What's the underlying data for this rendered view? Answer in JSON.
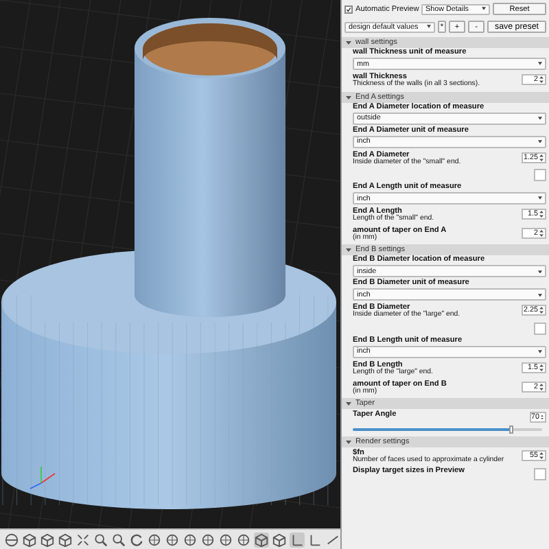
{
  "top_bar": {
    "auto_preview": {
      "label": "Automatic Preview",
      "checked": true
    },
    "details": {
      "value": "Show Details"
    },
    "reset": "Reset"
  },
  "preset_bar": {
    "preset": {
      "value": "design default values"
    },
    "buttons": [
      "*",
      "+",
      "-"
    ],
    "save": "save preset"
  },
  "sections": [
    {
      "title": "wall settings",
      "expanded": true,
      "params": [
        {
          "kind": "select",
          "label": "wall Thickness unit of measure",
          "value": "mm"
        },
        {
          "kind": "number",
          "label": "wall Thickness",
          "description": "Thickness of the walls (in all 3 sections).",
          "value": "2"
        }
      ]
    },
    {
      "title": "End A settings",
      "expanded": true,
      "params": [
        {
          "kind": "select",
          "label": "End A Diameter location of measure",
          "value": "outside"
        },
        {
          "kind": "select",
          "label": "End A Diameter unit of measure",
          "value": "inch"
        },
        {
          "kind": "number",
          "label": "End A Diameter",
          "description": "Inside diameter of the \"small\" end.",
          "value": "1.25"
        },
        {
          "kind": "checkbox",
          "checked": false
        },
        {
          "kind": "select",
          "label": "End A Length unit of measure",
          "value": "inch"
        },
        {
          "kind": "number",
          "label": "End A Length",
          "description": "Length of the \"small\" end.",
          "value": "1.5"
        },
        {
          "kind": "number",
          "label": "amount of taper on End A",
          "description": "(in mm)",
          "value": "2"
        }
      ]
    },
    {
      "title": "End B settings",
      "expanded": true,
      "params": [
        {
          "kind": "select",
          "label": "End B Diameter location of measure",
          "value": "inside"
        },
        {
          "kind": "select",
          "label": "End B Diameter unit of measure",
          "value": "inch"
        },
        {
          "kind": "number",
          "label": "End B Diameter",
          "description": "Inside diameter of the \"large\" end.",
          "value": "2.25"
        },
        {
          "kind": "checkbox",
          "checked": false
        },
        {
          "kind": "select",
          "label": "End B Length unit of measure",
          "value": "inch"
        },
        {
          "kind": "number",
          "label": "End B Length",
          "description": "Length of the \"large\" end.",
          "value": "1.5"
        },
        {
          "kind": "number",
          "label": "amount of taper on End B",
          "description": "(in mm)",
          "value": "2"
        }
      ]
    },
    {
      "title": "Taper",
      "expanded": true,
      "params": [
        {
          "kind": "slider",
          "label": "Taper Angle",
          "value": "70",
          "level": 0.84
        }
      ]
    },
    {
      "title": "Render settings",
      "expanded": true,
      "params": [
        {
          "kind": "number",
          "label": "$fn",
          "description": "Number of faces used to approximate a cylinder",
          "value": "55"
        },
        {
          "kind": "checkbox",
          "label": "Display target sizes in Preview",
          "checked": false
        }
      ]
    }
  ]
}
